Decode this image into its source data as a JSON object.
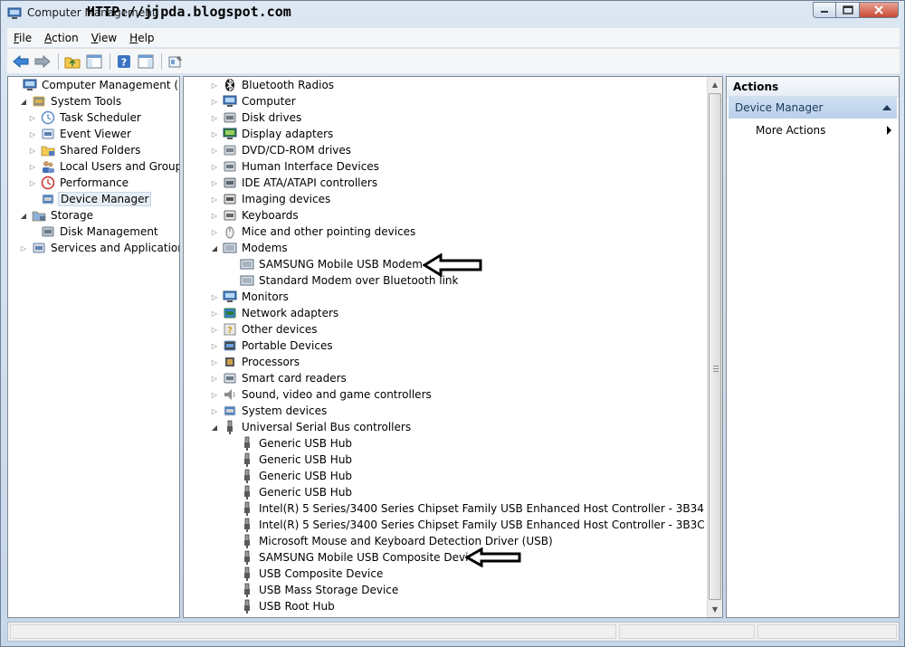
{
  "window": {
    "title": "Computer Management",
    "watermark": "HTTP://jjpda.blogspot.com"
  },
  "menu": {
    "items": [
      {
        "label": "File",
        "ul": "F",
        "rest": "ile"
      },
      {
        "label": "Action",
        "ul": "A",
        "rest": "ction"
      },
      {
        "label": "View",
        "ul": "V",
        "rest": "iew"
      },
      {
        "label": "Help",
        "ul": "H",
        "rest": "elp"
      }
    ]
  },
  "toolbar": {
    "buttons": [
      "back-arrow-icon",
      "forward-arrow-icon",
      "up-folder-icon",
      "show-hide-tree-icon",
      "help-icon",
      "show-hide-action-pane-icon",
      "properties-icon"
    ]
  },
  "left_tree": {
    "items": [
      {
        "label": "Computer Management (Local",
        "level": 0,
        "expander": "",
        "icon": "computer-management-icon"
      },
      {
        "label": "System Tools",
        "level": 1,
        "expander": "expanded",
        "icon": "system-tools-icon"
      },
      {
        "label": "Task Scheduler",
        "level": 2,
        "expander": "collapsed",
        "icon": "task-scheduler-icon"
      },
      {
        "label": "Event Viewer",
        "level": 2,
        "expander": "collapsed",
        "icon": "event-viewer-icon"
      },
      {
        "label": "Shared Folders",
        "level": 2,
        "expander": "collapsed",
        "icon": "shared-folders-icon"
      },
      {
        "label": "Local Users and Groups",
        "level": 2,
        "expander": "collapsed",
        "icon": "local-users-icon"
      },
      {
        "label": "Performance",
        "level": 2,
        "expander": "collapsed",
        "icon": "performance-icon"
      },
      {
        "label": "Device Manager",
        "level": 2,
        "expander": "",
        "icon": "device-manager-icon",
        "selected": true
      },
      {
        "label": "Storage",
        "level": 1,
        "expander": "expanded",
        "icon": "storage-icon"
      },
      {
        "label": "Disk Management",
        "level": 2,
        "expander": "",
        "icon": "disk-management-icon"
      },
      {
        "label": "Services and Applications",
        "level": 1,
        "expander": "collapsed",
        "icon": "services-icon"
      }
    ]
  },
  "device_tree": {
    "items": [
      {
        "label": "Bluetooth Radios",
        "level": 1,
        "expander": "collapsed",
        "icon": "bluetooth-icon"
      },
      {
        "label": "Computer",
        "level": 1,
        "expander": "collapsed",
        "icon": "computer-icon"
      },
      {
        "label": "Disk drives",
        "level": 1,
        "expander": "collapsed",
        "icon": "disk-drive-icon"
      },
      {
        "label": "Display adapters",
        "level": 1,
        "expander": "collapsed",
        "icon": "display-adapter-icon"
      },
      {
        "label": "DVD/CD-ROM drives",
        "level": 1,
        "expander": "collapsed",
        "icon": "dvd-drive-icon"
      },
      {
        "label": "Human Interface Devices",
        "level": 1,
        "expander": "collapsed",
        "icon": "hid-icon"
      },
      {
        "label": "IDE ATA/ATAPI controllers",
        "level": 1,
        "expander": "collapsed",
        "icon": "ide-controller-icon"
      },
      {
        "label": "Imaging devices",
        "level": 1,
        "expander": "collapsed",
        "icon": "camera-icon"
      },
      {
        "label": "Keyboards",
        "level": 1,
        "expander": "collapsed",
        "icon": "keyboard-icon"
      },
      {
        "label": "Mice and other pointing devices",
        "level": 1,
        "expander": "collapsed",
        "icon": "mouse-icon"
      },
      {
        "label": "Modems",
        "level": 1,
        "expander": "expanded",
        "icon": "modem-icon"
      },
      {
        "label": "SAMSUNG Mobile USB Modem",
        "level": 2,
        "expander": "",
        "icon": "modem-icon",
        "annotated": true
      },
      {
        "label": "Standard Modem over Bluetooth link",
        "level": 2,
        "expander": "",
        "icon": "modem-icon"
      },
      {
        "label": "Monitors",
        "level": 1,
        "expander": "collapsed",
        "icon": "monitor-icon"
      },
      {
        "label": "Network adapters",
        "level": 1,
        "expander": "collapsed",
        "icon": "network-adapter-icon"
      },
      {
        "label": "Other devices",
        "level": 1,
        "expander": "collapsed",
        "icon": "unknown-device-icon"
      },
      {
        "label": "Portable Devices",
        "level": 1,
        "expander": "collapsed",
        "icon": "portable-device-icon"
      },
      {
        "label": "Processors",
        "level": 1,
        "expander": "collapsed",
        "icon": "processor-icon"
      },
      {
        "label": "Smart card readers",
        "level": 1,
        "expander": "collapsed",
        "icon": "smart-card-icon"
      },
      {
        "label": "Sound, video and game controllers",
        "level": 1,
        "expander": "collapsed",
        "icon": "speaker-icon"
      },
      {
        "label": "System devices",
        "level": 1,
        "expander": "collapsed",
        "icon": "system-device-icon"
      },
      {
        "label": "Universal Serial Bus controllers",
        "level": 1,
        "expander": "expanded",
        "icon": "usb-icon"
      },
      {
        "label": "Generic USB Hub",
        "level": 2,
        "expander": "",
        "icon": "usb-icon"
      },
      {
        "label": "Generic USB Hub",
        "level": 2,
        "expander": "",
        "icon": "usb-icon"
      },
      {
        "label": "Generic USB Hub",
        "level": 2,
        "expander": "",
        "icon": "usb-icon"
      },
      {
        "label": "Generic USB Hub",
        "level": 2,
        "expander": "",
        "icon": "usb-icon"
      },
      {
        "label": "Intel(R) 5 Series/3400 Series Chipset Family USB Enhanced Host Controller - 3B34",
        "level": 2,
        "expander": "",
        "icon": "usb-icon"
      },
      {
        "label": "Intel(R) 5 Series/3400 Series Chipset Family USB Enhanced Host Controller - 3B3C",
        "level": 2,
        "expander": "",
        "icon": "usb-icon"
      },
      {
        "label": "Microsoft Mouse and Keyboard Detection Driver (USB)",
        "level": 2,
        "expander": "",
        "icon": "usb-icon"
      },
      {
        "label": "SAMSUNG Mobile USB Composite Device",
        "level": 2,
        "expander": "",
        "icon": "usb-icon",
        "annotated": true
      },
      {
        "label": "USB Composite Device",
        "level": 2,
        "expander": "",
        "icon": "usb-icon"
      },
      {
        "label": "USB Mass Storage Device",
        "level": 2,
        "expander": "",
        "icon": "usb-icon"
      },
      {
        "label": "USB Root Hub",
        "level": 2,
        "expander": "",
        "icon": "usb-icon"
      }
    ]
  },
  "actions": {
    "header": "Actions",
    "section": "Device Manager",
    "link": "More Actions"
  },
  "colors": {
    "selection": "#e8eef6",
    "action_section": "#c3d6ee",
    "frame": "#c9d9ea"
  }
}
